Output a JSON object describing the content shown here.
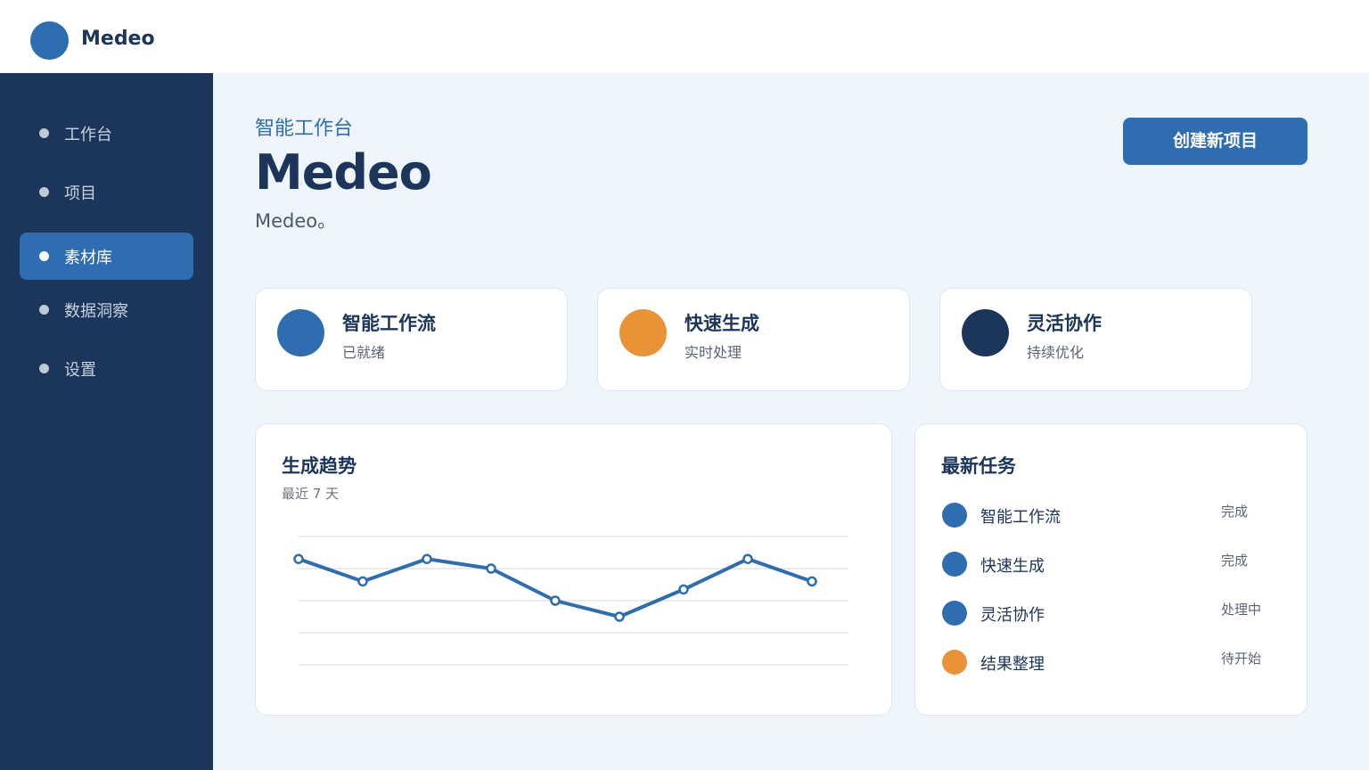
{
  "app": {
    "brand": "Medeo"
  },
  "sidebar": {
    "items": [
      {
        "label": "工作台",
        "active": false
      },
      {
        "label": "项目",
        "active": false
      },
      {
        "label": "素材库",
        "active": true
      },
      {
        "label": "数据洞察",
        "active": false
      },
      {
        "label": "设置",
        "active": false
      }
    ]
  },
  "header": {
    "kicker": "智能工作台",
    "title": "Medeo",
    "subtitle": "Medeo。",
    "create_button": "创建新项目"
  },
  "features": [
    {
      "title": "智能工作流",
      "subtitle": "已就绪",
      "color": "#2f6db1"
    },
    {
      "title": "快速生成",
      "subtitle": "实时处理",
      "color": "#ea9236"
    },
    {
      "title": "灵活协作",
      "subtitle": "持续优化",
      "color": "#1c355a"
    }
  ],
  "trend": {
    "title": "生成趋势",
    "subtitle": "最近 7 天"
  },
  "chart_data": {
    "type": "line",
    "title": "生成趋势",
    "subtitle": "最近 7 天",
    "xlabel": "",
    "ylabel": "",
    "ylim": [
      0,
      4
    ],
    "grid": true,
    "series": [
      {
        "values": [
          3.3,
          2.6,
          3.3,
          3.0,
          2.0,
          1.5,
          2.35,
          3.3,
          2.6
        ]
      }
    ],
    "color": "#2f6db1"
  },
  "tasks": {
    "title": "最新任务",
    "items": [
      {
        "name": "智能工作流",
        "status": "完成",
        "color": "#2f6db1"
      },
      {
        "name": "快速生成",
        "status": "完成",
        "color": "#2f6db1"
      },
      {
        "name": "灵活协作",
        "status": "处理中",
        "color": "#2f6db1"
      },
      {
        "name": "结果整理",
        "status": "待开始",
        "color": "#ea9236"
      }
    ]
  }
}
